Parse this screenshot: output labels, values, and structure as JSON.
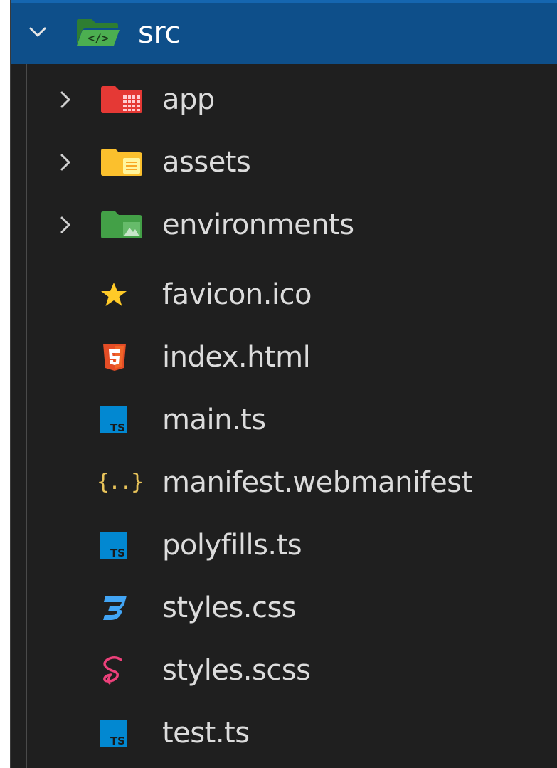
{
  "explorer": {
    "root": {
      "label": "src",
      "icon": "folder-src-open-icon",
      "expanded": true,
      "icon_color": "#4caf50"
    },
    "items": [
      {
        "label": "app",
        "kind": "folder",
        "icon": "folder-app-icon",
        "icon_color": "#ef5350"
      },
      {
        "label": "assets",
        "kind": "folder",
        "icon": "folder-assets-icon",
        "icon_color": "#fbc02d"
      },
      {
        "label": "environments",
        "kind": "folder",
        "icon": "folder-environments-icon",
        "icon_color": "#4caf50"
      },
      {
        "label": "favicon.ico",
        "kind": "file",
        "icon": "star-icon",
        "icon_color": "#ffca28"
      },
      {
        "label": "index.html",
        "kind": "file",
        "icon": "html5-icon",
        "icon_color": "#e44d26"
      },
      {
        "label": "main.ts",
        "kind": "file",
        "icon": "typescript-icon",
        "icon_color": "#0288d1"
      },
      {
        "label": "manifest.webmanifest",
        "kind": "file",
        "icon": "json-braces-icon",
        "icon_glyph": "{..}",
        "icon_color": "#e8c35a"
      },
      {
        "label": "polyfills.ts",
        "kind": "file",
        "icon": "typescript-icon",
        "icon_color": "#0288d1"
      },
      {
        "label": "styles.css",
        "kind": "file",
        "icon": "css3-icon",
        "icon_color": "#42a5f5"
      },
      {
        "label": "styles.scss",
        "kind": "file",
        "icon": "sass-icon",
        "icon_color": "#ec407a"
      },
      {
        "label": "test.ts",
        "kind": "file",
        "icon": "typescript-icon",
        "icon_color": "#0288d1"
      }
    ],
    "ts_badge": "TS"
  }
}
